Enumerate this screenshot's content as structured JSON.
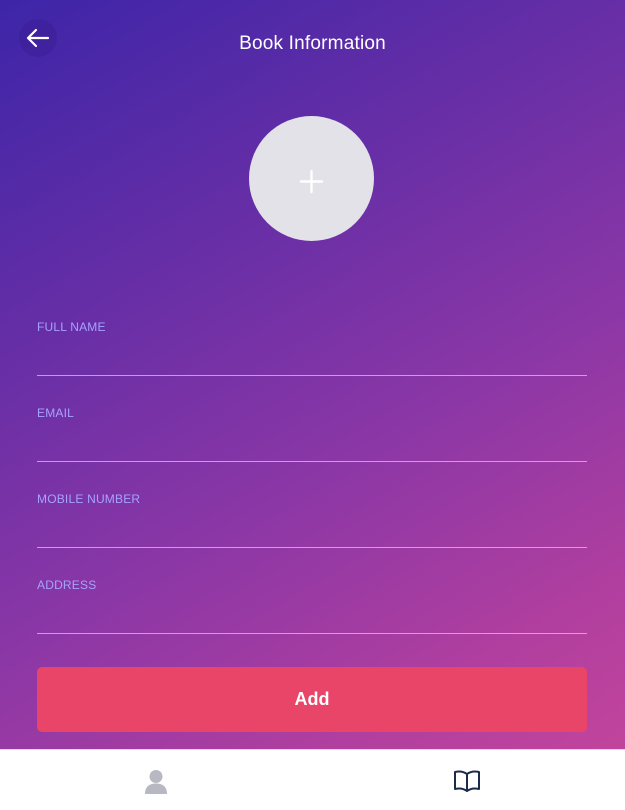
{
  "header": {
    "title": "Book Information",
    "back_icon": "arrow-left-icon"
  },
  "avatar": {
    "icon": "plus-icon"
  },
  "form": {
    "fields": [
      {
        "label": "FULL NAME",
        "value": ""
      },
      {
        "label": "EMAIL",
        "value": ""
      },
      {
        "label": "MOBILE NUMBER",
        "value": ""
      },
      {
        "label": "ADDRESS",
        "value": ""
      }
    ],
    "submit_label": "Add"
  },
  "tabbar": {
    "tabs": [
      {
        "icon": "user-icon",
        "active": false
      },
      {
        "icon": "book-open-icon",
        "active": true
      }
    ]
  },
  "colors": {
    "gradient_start": "#3d25a8",
    "gradient_end": "#c1449c",
    "field_label": "#a7a2ff",
    "button": "#e84569",
    "tab_inactive": "#b8b8c2",
    "tab_active": "#1d2b4a"
  }
}
